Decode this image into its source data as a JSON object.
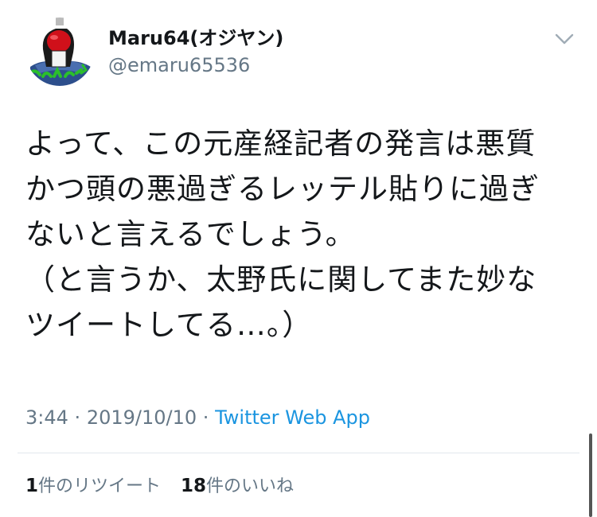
{
  "user": {
    "display_name": "Maru64(オジヤン)",
    "handle": "@emaru65536",
    "avatar_icon": "avatar-icon"
  },
  "menu": {
    "icon": "chevron-down-icon"
  },
  "tweet": {
    "lines": [
      "よって、この元産経記者の発言は悪質",
      "かつ頭の悪過ぎるレッテル貼りに過ぎ",
      "ないと言えるでしょう。",
      "（と言うか、太野氏に関してまた妙な",
      "ツイートしてる…。）"
    ]
  },
  "meta": {
    "time": "3:44",
    "date": "2019/10/10",
    "separator": "·",
    "source": "Twitter Web App"
  },
  "stats": {
    "retweets_count": "1",
    "retweets_label": "件のリツイート",
    "likes_count": "18",
    "likes_label": "件のいいね"
  },
  "colors": {
    "text": "#14171a",
    "secondary": "#657786",
    "link": "#1b95e0",
    "divider": "#e1e8ed"
  }
}
